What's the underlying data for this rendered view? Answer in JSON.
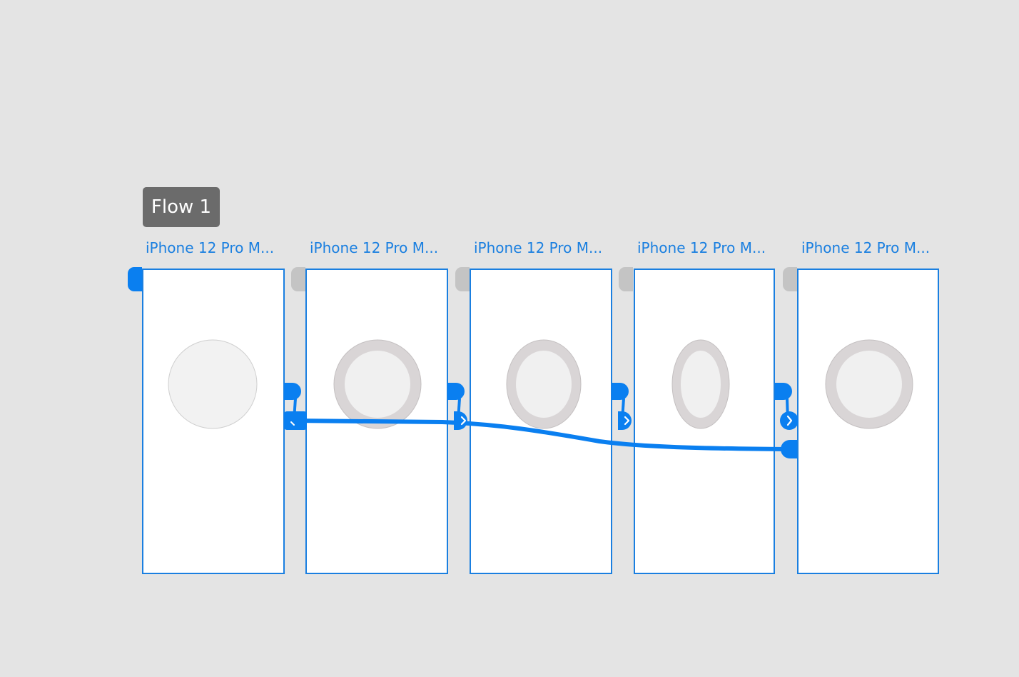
{
  "flow": {
    "label": "Flow 1"
  },
  "artboards": [
    {
      "title": "iPhone 12 Pro M...",
      "is_home": true
    },
    {
      "title": "iPhone 12 Pro M...",
      "is_home": false
    },
    {
      "title": "iPhone 12 Pro M...",
      "is_home": false
    },
    {
      "title": "iPhone 12 Pro M...",
      "is_home": false
    },
    {
      "title": "iPhone 12 Pro M...",
      "is_home": false
    }
  ],
  "colors": {
    "canvas_background": "#e4e4e4",
    "selection_blue": "#1a7fe0",
    "wire_blue": "#0a7ff0",
    "flow_badge": "#6b6b6b",
    "inactive_home_tab": "#c4c4c4",
    "ring_outer": "#d9d5d6",
    "ring_inner": "#f0f0f0"
  },
  "icons": {
    "home_marker": "home-indicator-tab",
    "wire_handle": "connector-handle-icon",
    "wire_arrow": "chevron-right-icon"
  }
}
